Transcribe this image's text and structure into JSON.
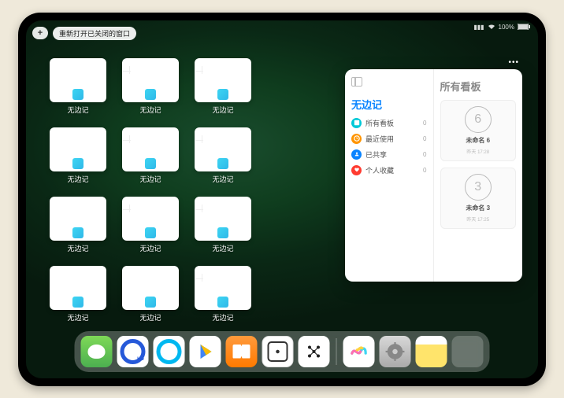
{
  "status": {
    "battery": "100%",
    "signal_icon": "signal-icon",
    "wifi_icon": "wifi-icon"
  },
  "topbar": {
    "plus": "+",
    "reopen_label": "重新打开已关闭的窗口"
  },
  "app_name": "无边记",
  "panel": {
    "title_left": "无边记",
    "title_right": "所有看板",
    "rows": [
      {
        "label": "所有看板",
        "count": "0",
        "color": "#00c8d7"
      },
      {
        "label": "最近使用",
        "count": "0",
        "color": "#ff9500"
      },
      {
        "label": "已共享",
        "count": "0",
        "color": "#0a84ff"
      },
      {
        "label": "个人收藏",
        "count": "0",
        "color": "#ff3b30"
      }
    ],
    "boards": [
      {
        "name": "未命名 6",
        "sub": "昨天 17:28",
        "sketch": "6"
      },
      {
        "name": "未命名 3",
        "sub": "昨天 17:25",
        "sketch": "3"
      }
    ]
  },
  "thumbs": [
    {
      "style": "blank"
    },
    {
      "style": "cal"
    },
    {
      "style": "cal"
    },
    null,
    {
      "style": "blank"
    },
    {
      "style": "cal"
    },
    {
      "style": "cal"
    },
    null,
    {
      "style": "blank"
    },
    {
      "style": "cal"
    },
    {
      "style": "cal"
    },
    null,
    {
      "style": "blank"
    },
    {
      "style": "blank"
    },
    {
      "style": "cal"
    },
    null
  ],
  "dock": {
    "groups": [
      [
        "wechat",
        "qhd",
        "q2",
        "play",
        "books",
        "die",
        "dots"
      ],
      [
        "freeform",
        "settings",
        "notes",
        "multi"
      ]
    ]
  }
}
